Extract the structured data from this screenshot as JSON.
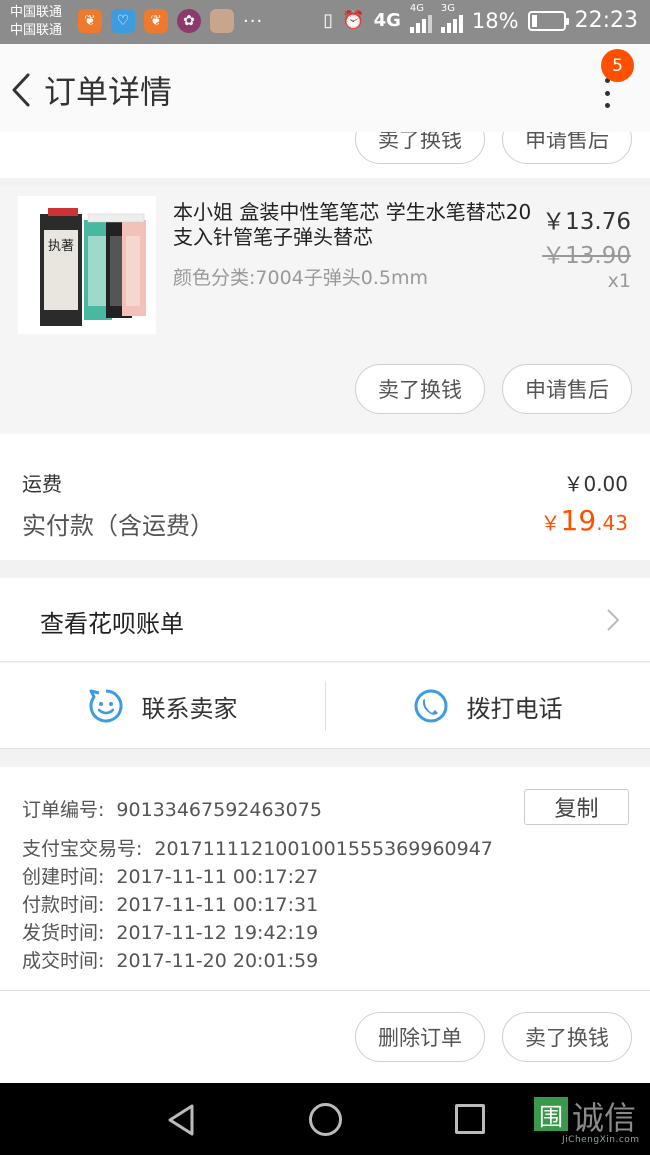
{
  "status_bar": {
    "carrier_1": "中国联通",
    "carrier_2": "中国联通",
    "net_1": "4G",
    "net_2": "4G",
    "net_3": "3G",
    "battery": "18%",
    "time": "22:23"
  },
  "header": {
    "title": "订单详情",
    "badge_count": "5"
  },
  "prev_item": {
    "sell_label": "卖了换钱",
    "after_sale_label": "申请售后"
  },
  "product": {
    "name": "本小姐 盒装中性笔笔芯 学生水笔替芯20支入针管笔子弹头替芯",
    "spec": "颜色分类:7004子弹头0.5mm",
    "price": "￥13.76",
    "original_price": "￥13.90",
    "quantity": "x1",
    "sell_label": "卖了换钱",
    "after_sale_label": "申请售后",
    "thumb_text": "执著"
  },
  "totals": {
    "shipping_label": "运费",
    "shipping_value": "￥0.00",
    "paid_label": "实付款（含运费）",
    "paid_currency": "￥",
    "paid_integer": "19",
    "paid_decimal": ".43"
  },
  "huabei": {
    "label": "查看花呗账单"
  },
  "contact": {
    "seller_label": "联系卖家",
    "phone_label": "拨打电话"
  },
  "order_info": {
    "order_no_label": "订单编号:",
    "order_no": "90133467592463075",
    "copy_label": "复制",
    "alipay_label": "支付宝交易号:",
    "alipay_no": "2017111121001001555369960947",
    "created_label": "创建时间:",
    "created": "2017-11-11 00:17:27",
    "paid_label": "付款时间:",
    "paid": "2017-11-11 00:17:31",
    "shipped_label": "发货时间:",
    "shipped": "2017-11-12 19:42:19",
    "completed_label": "成交时间:",
    "completed": "2017-11-20 20:01:59"
  },
  "actions": {
    "delete_label": "删除订单",
    "sell_label": "卖了换钱"
  },
  "watermark": {
    "logo_char": "围",
    "text": "诚信",
    "sub": "JiChengXin.com"
  },
  "colors": {
    "accent": "#ff5000",
    "icon_blue": "#3d9be0"
  }
}
